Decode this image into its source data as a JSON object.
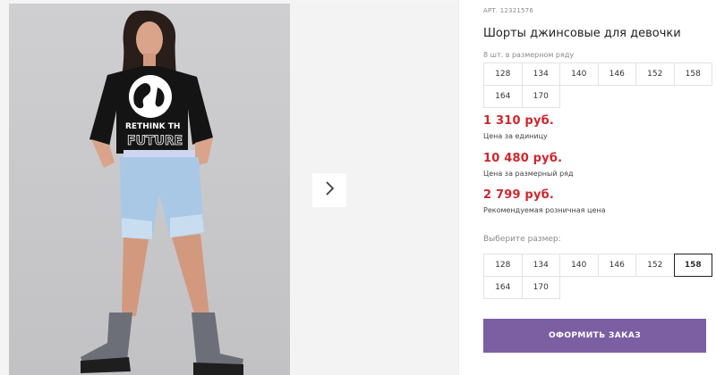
{
  "product": {
    "article_label": "АРТ.",
    "article_number": "12321576",
    "title": "Шорты джинсовые для девочки"
  },
  "size_row": {
    "label": "8 шт. в размерном ряду",
    "sizes": [
      "128",
      "134",
      "140",
      "146",
      "152",
      "158",
      "164",
      "170"
    ]
  },
  "prices": [
    {
      "value": "1 310 руб.",
      "label": "Цена за единицу"
    },
    {
      "value": "10 480 руб.",
      "label": "Цена за размерный ряд"
    },
    {
      "value": "2 799 руб.",
      "label": "Рекомендуемая розничная цена"
    }
  ],
  "size_picker": {
    "label": "Выберите размер:",
    "sizes": [
      "128",
      "134",
      "140",
      "146",
      "152",
      "158",
      "164",
      "170"
    ],
    "selected": "158"
  },
  "order_button": {
    "label": "ОФОРМИТЬ ЗАКАЗ"
  },
  "photo": {
    "shirt_text_line1": "RETHINK TH",
    "shirt_text_line2": "FUTURE"
  },
  "colors": {
    "price": "#d0262d",
    "button": "#7c5fa3",
    "selected_border": "#222222"
  },
  "icons": {
    "next": "chevron-right-icon"
  }
}
